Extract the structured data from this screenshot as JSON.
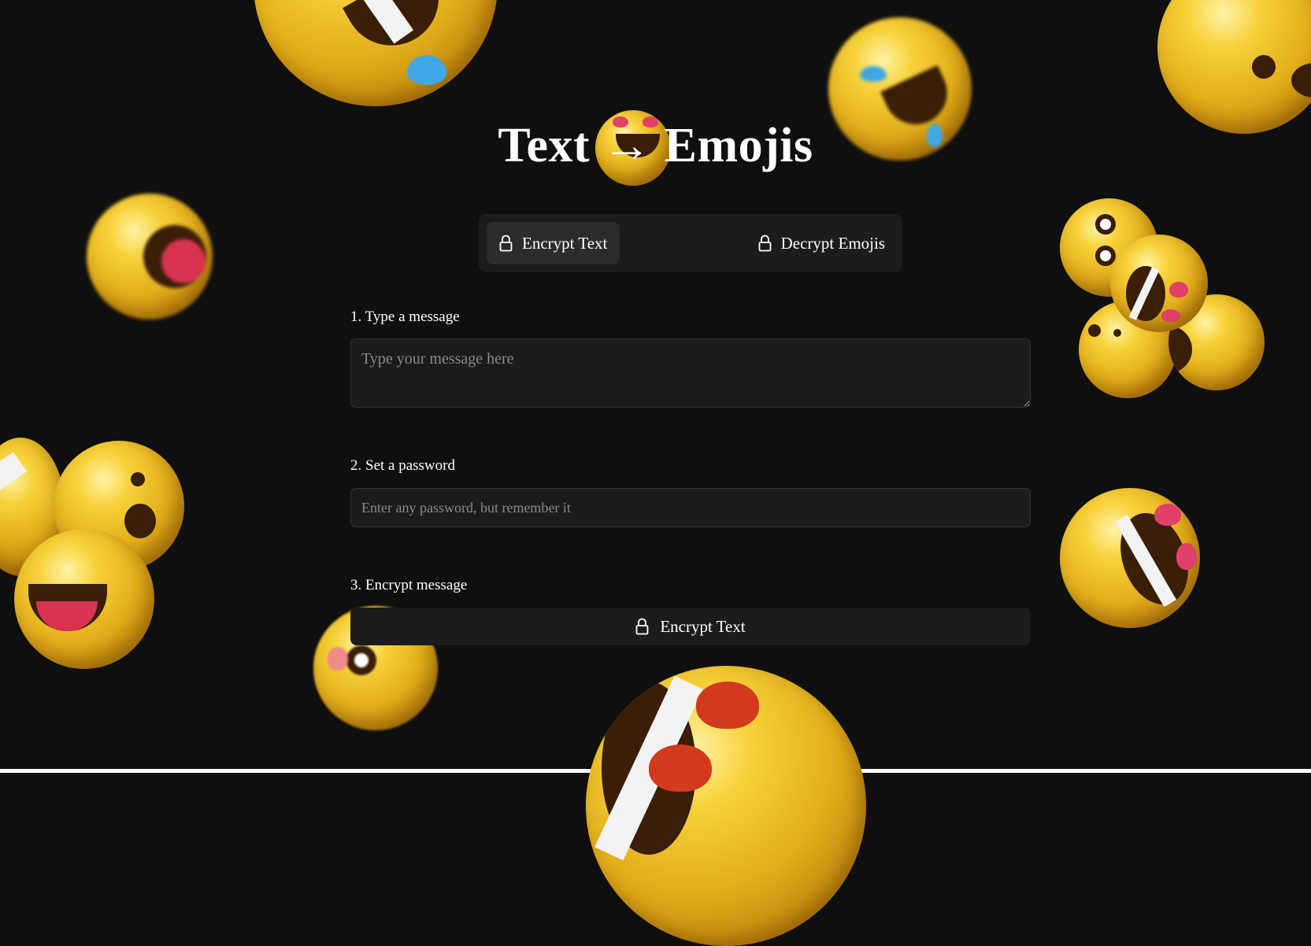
{
  "title": "Text → Emojis",
  "tabs": [
    {
      "label": "Encrypt Text",
      "icon": "lock-icon",
      "active": true
    },
    {
      "label": "Decrypt Emojis",
      "icon": "lock-icon",
      "active": false
    }
  ],
  "form": {
    "step1_label": "1. Type a message",
    "message_placeholder": "Type your message here",
    "message_value": "",
    "step2_label": "2. Set a password",
    "password_placeholder": "Enter any password, but remember it",
    "password_value": "",
    "step3_label": "3. Encrypt message",
    "encrypt_button_label": "Encrypt Text"
  },
  "colors": {
    "background": "#0f0f0f",
    "panel": "#1c1c1c",
    "active_tab": "#2b2b2b",
    "text": "#ffffff",
    "emoji_yellow": "#f2c522"
  }
}
